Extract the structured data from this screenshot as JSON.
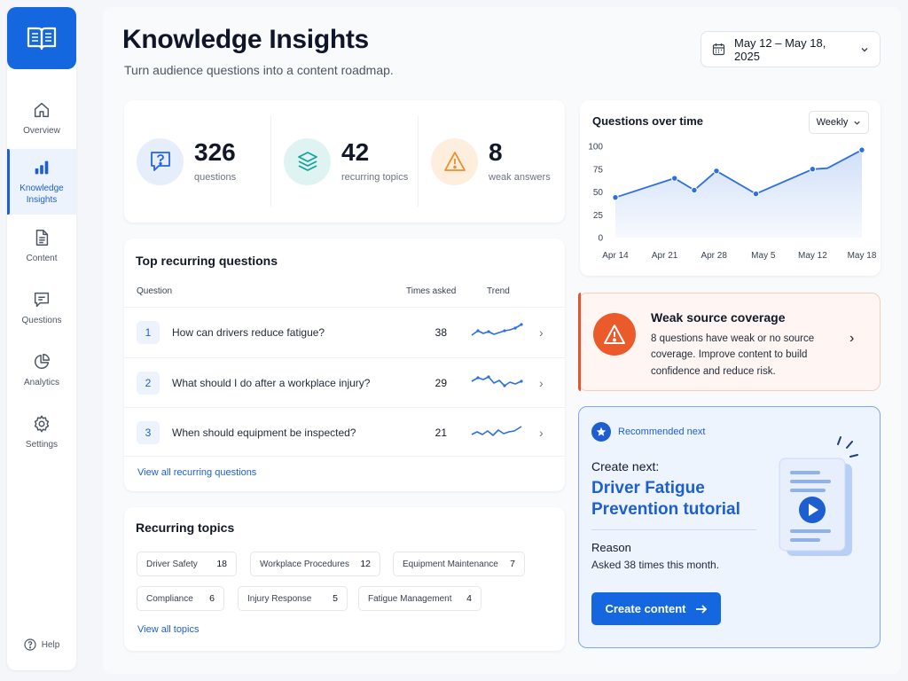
{
  "header": {
    "title": "Knowledge Insights",
    "subtitle": "Turn audience questions into a content roadmap.",
    "date_range": "May 12 – May 18, 2025"
  },
  "sidebar": {
    "items": [
      {
        "label": "Overview",
        "icon": "home-icon"
      },
      {
        "label": "Knowledge Insights",
        "icon": "bar-chart-icon",
        "active": true
      },
      {
        "label": "Content",
        "icon": "document-icon"
      },
      {
        "label": "Questions",
        "icon": "message-icon"
      },
      {
        "label": "Analytics",
        "icon": "pie-chart-icon"
      },
      {
        "label": "Settings",
        "icon": "gear-icon"
      }
    ],
    "help": "Help"
  },
  "stats": [
    {
      "value": "326",
      "label": "questions",
      "icon": "question-icon",
      "color": "#2563eb"
    },
    {
      "value": "42",
      "label": "recurring topics",
      "icon": "layers-icon",
      "color": "#14a39a"
    },
    {
      "value": "8",
      "label": "weak answers",
      "icon": "warning-icon",
      "color": "#f08c2a"
    }
  ],
  "questions": {
    "title": "Top recurring questions",
    "columns": {
      "question": "Question",
      "times": "Times asked",
      "trend": "Trend"
    },
    "rows": [
      {
        "num": "1",
        "text": "How can drivers reduce fatigue?",
        "count": "38"
      },
      {
        "num": "2",
        "text": "What should I do after a workplace injury?",
        "count": "29"
      },
      {
        "num": "3",
        "text": "When should equipment be inspected?",
        "count": "21"
      }
    ],
    "view_all": "View all recurring questions"
  },
  "topics": {
    "title": "Recurring topics",
    "chips": [
      {
        "label": "Driver Safety",
        "count": "18"
      },
      {
        "label": "Workplace Procedures",
        "count": "12"
      },
      {
        "label": "Equipment Maintenance",
        "count": "7"
      },
      {
        "label": "Compliance",
        "count": "6"
      },
      {
        "label": "Injury Response",
        "count": "5"
      },
      {
        "label": "Fatigue Management",
        "count": "4"
      }
    ],
    "view_all": "View all topics"
  },
  "chart": {
    "title": "Questions over time",
    "period": "Weekly"
  },
  "chart_data": {
    "type": "area",
    "title": "Questions over time",
    "x": [
      "Apr 14",
      "Apr 21",
      "Apr 28",
      "May 5",
      "May 12",
      "May 18"
    ],
    "x_positions": [
      0,
      1,
      2,
      3,
      4,
      5
    ],
    "series": [
      {
        "values": [
          [
            0,
            44
          ],
          [
            1.2,
            65
          ],
          [
            1.6,
            52
          ],
          [
            2.05,
            73
          ],
          [
            2.85,
            48
          ],
          [
            4,
            75
          ],
          [
            4.3,
            76
          ],
          [
            5,
            96
          ]
        ]
      }
    ],
    "ylim": [
      0,
      100
    ],
    "yticks": [
      0,
      25,
      50,
      75,
      100
    ],
    "marked_points": [
      0,
      1,
      2,
      3,
      4,
      5,
      7
    ],
    "grid": false
  },
  "weak": {
    "title": "Weak source coverage",
    "text": "8 questions have weak or no source coverage. Improve content to build confidence and reduce risk."
  },
  "recommended": {
    "tag": "Recommended next",
    "create_label": "Create next:",
    "title": "Driver Fatigue Prevention tutorial",
    "reason_label": "Reason",
    "reason": "Asked 38 times this month.",
    "button": "Create content"
  },
  "colors": {
    "primary": "#1567e0",
    "warning": "#ea5a2b",
    "teal": "#14a39a"
  }
}
